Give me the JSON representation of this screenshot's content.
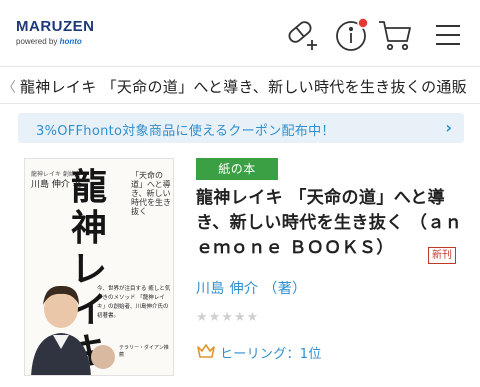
{
  "header": {
    "logo_main": "MARUZEN",
    "logo_sub_prefix": "powered by ",
    "logo_sub_brand": "honto",
    "icons": [
      "supplement-icon",
      "info-icon",
      "cart-icon",
      "menu-icon"
    ],
    "accent_color": "#2d8fd0",
    "notification_dot_color": "#e53935"
  },
  "breadcrumb": {
    "text": "龍神レイキ 「天命の道」へと導き、新しい時代を生き抜くの通販"
  },
  "banner": {
    "text": "3%OFFhonto対象商品に使えるクーポン配布中！"
  },
  "cover": {
    "small_text": "龍神レイキ 創始者",
    "author": "川島 伸介 著",
    "title": "龍神レイキ",
    "subtitle": "「天命の道」へと導き、新しい時代を生き抜く",
    "blurb": "今、世界が注目する 癒しと気づきのメソッド 「龍神レイキ」の創始者、川島伸介氏の初著書。",
    "note": "テラリー・ダイアン推薦"
  },
  "product": {
    "format_tag": "紙の本",
    "format_tag_color": "#3aa043",
    "title": "龍神レイキ 「天命の道」へと導き、新しい時代を生き抜く （ａｎｅｍｏｎｅ ＢＯＯＫＳ）",
    "new_badge": "新刊",
    "author": "川島 伸介 （著）",
    "stars": "★★★★★",
    "rating": 0,
    "ranking": "ヒーリング：1位"
  }
}
